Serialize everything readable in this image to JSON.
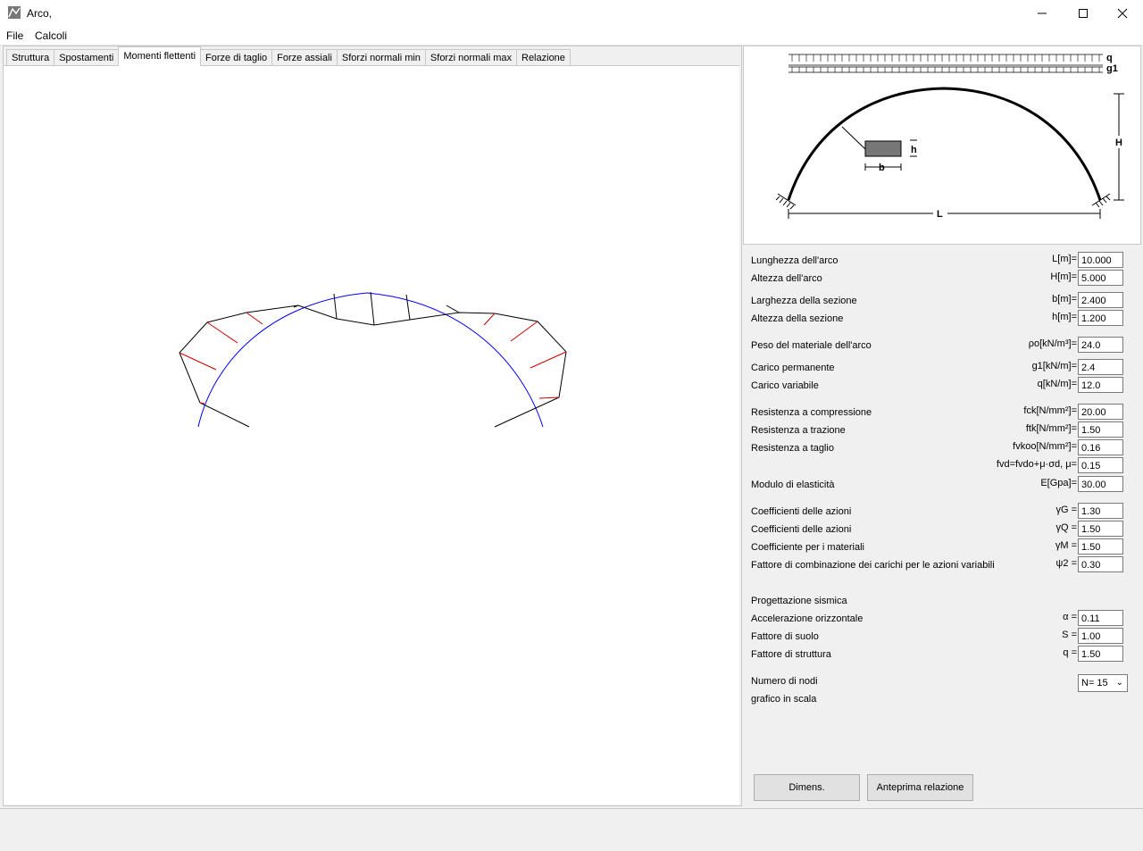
{
  "window": {
    "title": "Arco,"
  },
  "menu": {
    "file": "File",
    "calcoli": "Calcoli"
  },
  "tabs": [
    {
      "label": "Struttura"
    },
    {
      "label": "Spostamenti"
    },
    {
      "label": "Momenti flettenti"
    },
    {
      "label": "Forze di taglio"
    },
    {
      "label": "Forze assiali"
    },
    {
      "label": "Sforzi normali min"
    },
    {
      "label": "Sforzi normali max"
    },
    {
      "label": "Relazione"
    }
  ],
  "active_tab": "Momenti flettenti",
  "diagram": {
    "q": "q",
    "g1": "g1",
    "h": "h",
    "b": "b",
    "H": "H",
    "L": "L"
  },
  "params": [
    {
      "label": "Lunghezza dell'arco",
      "sym": "L[m]=",
      "value": "10.000"
    },
    {
      "label": "Altezza dell'arco",
      "sym": "H[m]=",
      "value": "5.000"
    },
    {
      "label": "Larghezza della sezione",
      "sym": "b[m]=",
      "value": "2.400"
    },
    {
      "label": "Altezza della sezione",
      "sym": "h[m]=",
      "value": "1.200"
    },
    {
      "label": "Peso del materiale dell'arco",
      "sym": "ρo[kN/m³]=",
      "value": "24.0"
    },
    {
      "label": "Carico permanente",
      "sym": "g1[kN/m]=",
      "value": "2.4"
    },
    {
      "label": "Carico variabile",
      "sym": "q[kN/m]=",
      "value": "12.0"
    },
    {
      "label": "Resistenza a compressione",
      "sym": "fck[N/mm²]=",
      "value": "20.00"
    },
    {
      "label": "Resistenza a trazione",
      "sym": "ftk[N/mm²]=",
      "value": "1.50"
    },
    {
      "label": "Resistenza a taglio",
      "sym": "fvkoo[N/mm²]=",
      "value": "0.16"
    },
    {
      "label": "",
      "sym": "fvd=fvdo+μ·σd, μ=",
      "value": "0.15"
    },
    {
      "label": "Modulo di elasticità",
      "sym": "E[Gpa]=",
      "value": "30.00"
    },
    {
      "label": "Coefficienti delle azioni",
      "sym": "γG =",
      "value": "1.30"
    },
    {
      "label": "Coefficienti delle azioni",
      "sym": "γQ =",
      "value": "1.50"
    },
    {
      "label": "Coefficiente per i materiali",
      "sym": "γM =",
      "value": "1.50"
    },
    {
      "label": "Fattore di combinazione dei carichi per le azioni variabili",
      "sym": "ψ2 =",
      "value": "0.30"
    },
    {
      "label": "Progettazione sismica",
      "sym": "",
      "value": ""
    },
    {
      "label": "Accelerazione orizzontale",
      "sym": "α =",
      "value": "0.11"
    },
    {
      "label": "Fattore di suolo",
      "sym": "S =",
      "value": "1.00"
    },
    {
      "label": "Fattore di struttura",
      "sym": "q =",
      "value": "1.50"
    }
  ],
  "nodes": {
    "label": "Numero di nodi",
    "value": "N= 15",
    "scale_label": "grafico in scala"
  },
  "buttons": {
    "dimens": "Dimens.",
    "anteprima": "Anteprima relazione"
  }
}
